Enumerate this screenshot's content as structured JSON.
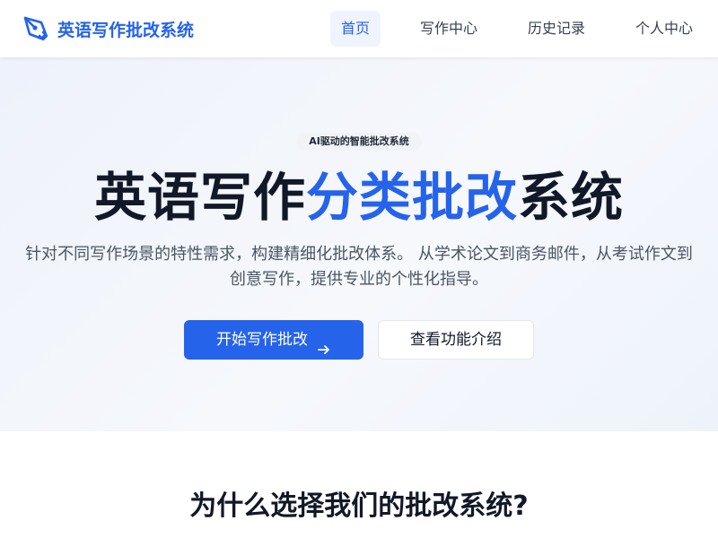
{
  "header": {
    "brand_title": "英语写作批改系统",
    "brand_icon": "pen-nib-icon",
    "nav": [
      {
        "label": "首页",
        "active": true
      },
      {
        "label": "写作中心",
        "active": false
      },
      {
        "label": "历史记录",
        "active": false
      },
      {
        "label": "个人中心",
        "active": false
      }
    ]
  },
  "hero": {
    "badge": "AI驱动的智能批改系统",
    "title_part1": "英语写作",
    "title_accent": "分类批改",
    "title_part2": "系统",
    "description": "针对不同写作场景的特性需求，构建精细化批改体系。 从学术论文到商务邮件，从考试作文到创意写作，提供专业的个性化指导。",
    "primary_button": "开始写作批改",
    "primary_button_icon": "arrow-right-icon",
    "secondary_button": "查看功能介绍"
  },
  "section": {
    "title": "为什么选择我们的批改系统?"
  },
  "colors": {
    "accent": "#2563eb",
    "text_dark": "#111827",
    "text_muted": "#4b5563"
  }
}
